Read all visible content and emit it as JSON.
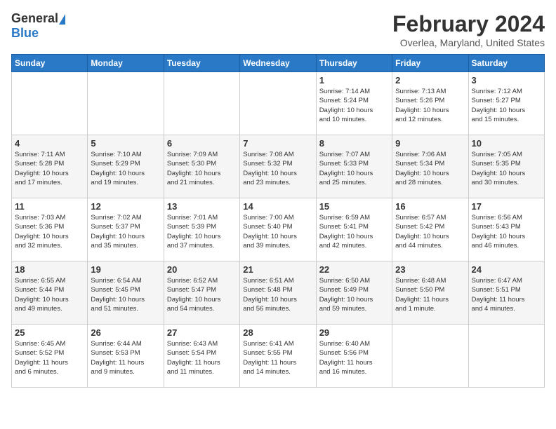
{
  "header": {
    "logo_general": "General",
    "logo_blue": "Blue",
    "title": "February 2024",
    "subtitle": "Overlea, Maryland, United States"
  },
  "days_of_week": [
    "Sunday",
    "Monday",
    "Tuesday",
    "Wednesday",
    "Thursday",
    "Friday",
    "Saturday"
  ],
  "weeks": [
    [
      {
        "day": "",
        "info": ""
      },
      {
        "day": "",
        "info": ""
      },
      {
        "day": "",
        "info": ""
      },
      {
        "day": "",
        "info": ""
      },
      {
        "day": "1",
        "info": "Sunrise: 7:14 AM\nSunset: 5:24 PM\nDaylight: 10 hours\nand 10 minutes."
      },
      {
        "day": "2",
        "info": "Sunrise: 7:13 AM\nSunset: 5:26 PM\nDaylight: 10 hours\nand 12 minutes."
      },
      {
        "day": "3",
        "info": "Sunrise: 7:12 AM\nSunset: 5:27 PM\nDaylight: 10 hours\nand 15 minutes."
      }
    ],
    [
      {
        "day": "4",
        "info": "Sunrise: 7:11 AM\nSunset: 5:28 PM\nDaylight: 10 hours\nand 17 minutes."
      },
      {
        "day": "5",
        "info": "Sunrise: 7:10 AM\nSunset: 5:29 PM\nDaylight: 10 hours\nand 19 minutes."
      },
      {
        "day": "6",
        "info": "Sunrise: 7:09 AM\nSunset: 5:30 PM\nDaylight: 10 hours\nand 21 minutes."
      },
      {
        "day": "7",
        "info": "Sunrise: 7:08 AM\nSunset: 5:32 PM\nDaylight: 10 hours\nand 23 minutes."
      },
      {
        "day": "8",
        "info": "Sunrise: 7:07 AM\nSunset: 5:33 PM\nDaylight: 10 hours\nand 25 minutes."
      },
      {
        "day": "9",
        "info": "Sunrise: 7:06 AM\nSunset: 5:34 PM\nDaylight: 10 hours\nand 28 minutes."
      },
      {
        "day": "10",
        "info": "Sunrise: 7:05 AM\nSunset: 5:35 PM\nDaylight: 10 hours\nand 30 minutes."
      }
    ],
    [
      {
        "day": "11",
        "info": "Sunrise: 7:03 AM\nSunset: 5:36 PM\nDaylight: 10 hours\nand 32 minutes."
      },
      {
        "day": "12",
        "info": "Sunrise: 7:02 AM\nSunset: 5:37 PM\nDaylight: 10 hours\nand 35 minutes."
      },
      {
        "day": "13",
        "info": "Sunrise: 7:01 AM\nSunset: 5:39 PM\nDaylight: 10 hours\nand 37 minutes."
      },
      {
        "day": "14",
        "info": "Sunrise: 7:00 AM\nSunset: 5:40 PM\nDaylight: 10 hours\nand 39 minutes."
      },
      {
        "day": "15",
        "info": "Sunrise: 6:59 AM\nSunset: 5:41 PM\nDaylight: 10 hours\nand 42 minutes."
      },
      {
        "day": "16",
        "info": "Sunrise: 6:57 AM\nSunset: 5:42 PM\nDaylight: 10 hours\nand 44 minutes."
      },
      {
        "day": "17",
        "info": "Sunrise: 6:56 AM\nSunset: 5:43 PM\nDaylight: 10 hours\nand 46 minutes."
      }
    ],
    [
      {
        "day": "18",
        "info": "Sunrise: 6:55 AM\nSunset: 5:44 PM\nDaylight: 10 hours\nand 49 minutes."
      },
      {
        "day": "19",
        "info": "Sunrise: 6:54 AM\nSunset: 5:45 PM\nDaylight: 10 hours\nand 51 minutes."
      },
      {
        "day": "20",
        "info": "Sunrise: 6:52 AM\nSunset: 5:47 PM\nDaylight: 10 hours\nand 54 minutes."
      },
      {
        "day": "21",
        "info": "Sunrise: 6:51 AM\nSunset: 5:48 PM\nDaylight: 10 hours\nand 56 minutes."
      },
      {
        "day": "22",
        "info": "Sunrise: 6:50 AM\nSunset: 5:49 PM\nDaylight: 10 hours\nand 59 minutes."
      },
      {
        "day": "23",
        "info": "Sunrise: 6:48 AM\nSunset: 5:50 PM\nDaylight: 11 hours\nand 1 minute."
      },
      {
        "day": "24",
        "info": "Sunrise: 6:47 AM\nSunset: 5:51 PM\nDaylight: 11 hours\nand 4 minutes."
      }
    ],
    [
      {
        "day": "25",
        "info": "Sunrise: 6:45 AM\nSunset: 5:52 PM\nDaylight: 11 hours\nand 6 minutes."
      },
      {
        "day": "26",
        "info": "Sunrise: 6:44 AM\nSunset: 5:53 PM\nDaylight: 11 hours\nand 9 minutes."
      },
      {
        "day": "27",
        "info": "Sunrise: 6:43 AM\nSunset: 5:54 PM\nDaylight: 11 hours\nand 11 minutes."
      },
      {
        "day": "28",
        "info": "Sunrise: 6:41 AM\nSunset: 5:55 PM\nDaylight: 11 hours\nand 14 minutes."
      },
      {
        "day": "29",
        "info": "Sunrise: 6:40 AM\nSunset: 5:56 PM\nDaylight: 11 hours\nand 16 minutes."
      },
      {
        "day": "",
        "info": ""
      },
      {
        "day": "",
        "info": ""
      }
    ]
  ]
}
